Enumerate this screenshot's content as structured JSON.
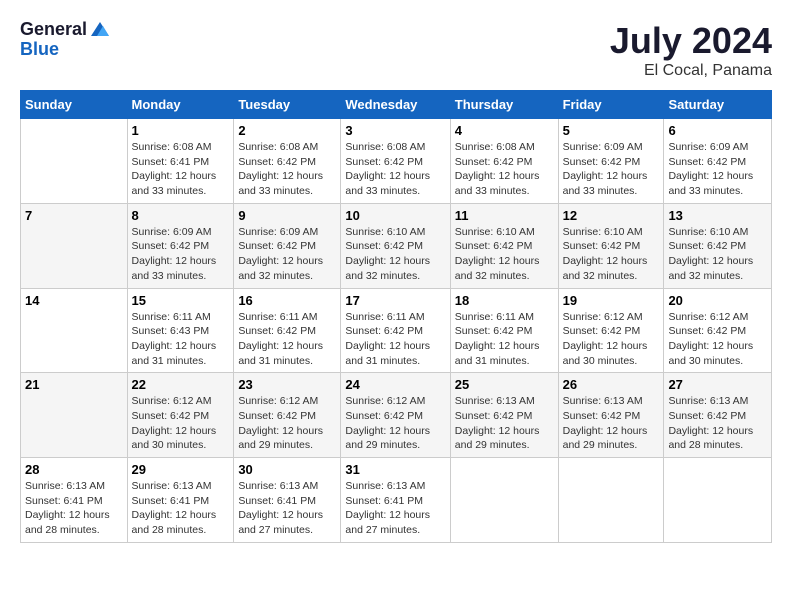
{
  "header": {
    "logo_general": "General",
    "logo_blue": "Blue",
    "title": "July 2024",
    "subtitle": "El Cocal, Panama"
  },
  "days_of_week": [
    "Sunday",
    "Monday",
    "Tuesday",
    "Wednesday",
    "Thursday",
    "Friday",
    "Saturday"
  ],
  "weeks": [
    [
      {
        "day": "",
        "info": ""
      },
      {
        "day": "1",
        "info": "Sunrise: 6:08 AM\nSunset: 6:41 PM\nDaylight: 12 hours\nand 33 minutes."
      },
      {
        "day": "2",
        "info": "Sunrise: 6:08 AM\nSunset: 6:42 PM\nDaylight: 12 hours\nand 33 minutes."
      },
      {
        "day": "3",
        "info": "Sunrise: 6:08 AM\nSunset: 6:42 PM\nDaylight: 12 hours\nand 33 minutes."
      },
      {
        "day": "4",
        "info": "Sunrise: 6:08 AM\nSunset: 6:42 PM\nDaylight: 12 hours\nand 33 minutes."
      },
      {
        "day": "5",
        "info": "Sunrise: 6:09 AM\nSunset: 6:42 PM\nDaylight: 12 hours\nand 33 minutes."
      },
      {
        "day": "6",
        "info": "Sunrise: 6:09 AM\nSunset: 6:42 PM\nDaylight: 12 hours\nand 33 minutes."
      }
    ],
    [
      {
        "day": "7",
        "info": ""
      },
      {
        "day": "8",
        "info": "Sunrise: 6:09 AM\nSunset: 6:42 PM\nDaylight: 12 hours\nand 33 minutes."
      },
      {
        "day": "9",
        "info": "Sunrise: 6:09 AM\nSunset: 6:42 PM\nDaylight: 12 hours\nand 32 minutes."
      },
      {
        "day": "10",
        "info": "Sunrise: 6:10 AM\nSunset: 6:42 PM\nDaylight: 12 hours\nand 32 minutes."
      },
      {
        "day": "11",
        "info": "Sunrise: 6:10 AM\nSunset: 6:42 PM\nDaylight: 12 hours\nand 32 minutes."
      },
      {
        "day": "12",
        "info": "Sunrise: 6:10 AM\nSunset: 6:42 PM\nDaylight: 12 hours\nand 32 minutes."
      },
      {
        "day": "13",
        "info": "Sunrise: 6:10 AM\nSunset: 6:42 PM\nDaylight: 12 hours\nand 32 minutes."
      }
    ],
    [
      {
        "day": "14",
        "info": ""
      },
      {
        "day": "15",
        "info": "Sunrise: 6:11 AM\nSunset: 6:43 PM\nDaylight: 12 hours\nand 31 minutes."
      },
      {
        "day": "16",
        "info": "Sunrise: 6:11 AM\nSunset: 6:42 PM\nDaylight: 12 hours\nand 31 minutes."
      },
      {
        "day": "17",
        "info": "Sunrise: 6:11 AM\nSunset: 6:42 PM\nDaylight: 12 hours\nand 31 minutes."
      },
      {
        "day": "18",
        "info": "Sunrise: 6:11 AM\nSunset: 6:42 PM\nDaylight: 12 hours\nand 31 minutes."
      },
      {
        "day": "19",
        "info": "Sunrise: 6:12 AM\nSunset: 6:42 PM\nDaylight: 12 hours\nand 30 minutes."
      },
      {
        "day": "20",
        "info": "Sunrise: 6:12 AM\nSunset: 6:42 PM\nDaylight: 12 hours\nand 30 minutes."
      }
    ],
    [
      {
        "day": "21",
        "info": ""
      },
      {
        "day": "22",
        "info": "Sunrise: 6:12 AM\nSunset: 6:42 PM\nDaylight: 12 hours\nand 30 minutes."
      },
      {
        "day": "23",
        "info": "Sunrise: 6:12 AM\nSunset: 6:42 PM\nDaylight: 12 hours\nand 29 minutes."
      },
      {
        "day": "24",
        "info": "Sunrise: 6:12 AM\nSunset: 6:42 PM\nDaylight: 12 hours\nand 29 minutes."
      },
      {
        "day": "25",
        "info": "Sunrise: 6:13 AM\nSunset: 6:42 PM\nDaylight: 12 hours\nand 29 minutes."
      },
      {
        "day": "26",
        "info": "Sunrise: 6:13 AM\nSunset: 6:42 PM\nDaylight: 12 hours\nand 29 minutes."
      },
      {
        "day": "27",
        "info": "Sunrise: 6:13 AM\nSunset: 6:42 PM\nDaylight: 12 hours\nand 28 minutes."
      }
    ],
    [
      {
        "day": "28",
        "info": "Sunrise: 6:13 AM\nSunset: 6:41 PM\nDaylight: 12 hours\nand 28 minutes."
      },
      {
        "day": "29",
        "info": "Sunrise: 6:13 AM\nSunset: 6:41 PM\nDaylight: 12 hours\nand 28 minutes."
      },
      {
        "day": "30",
        "info": "Sunrise: 6:13 AM\nSunset: 6:41 PM\nDaylight: 12 hours\nand 27 minutes."
      },
      {
        "day": "31",
        "info": "Sunrise: 6:13 AM\nSunset: 6:41 PM\nDaylight: 12 hours\nand 27 minutes."
      },
      {
        "day": "",
        "info": ""
      },
      {
        "day": "",
        "info": ""
      },
      {
        "day": "",
        "info": ""
      }
    ]
  ]
}
